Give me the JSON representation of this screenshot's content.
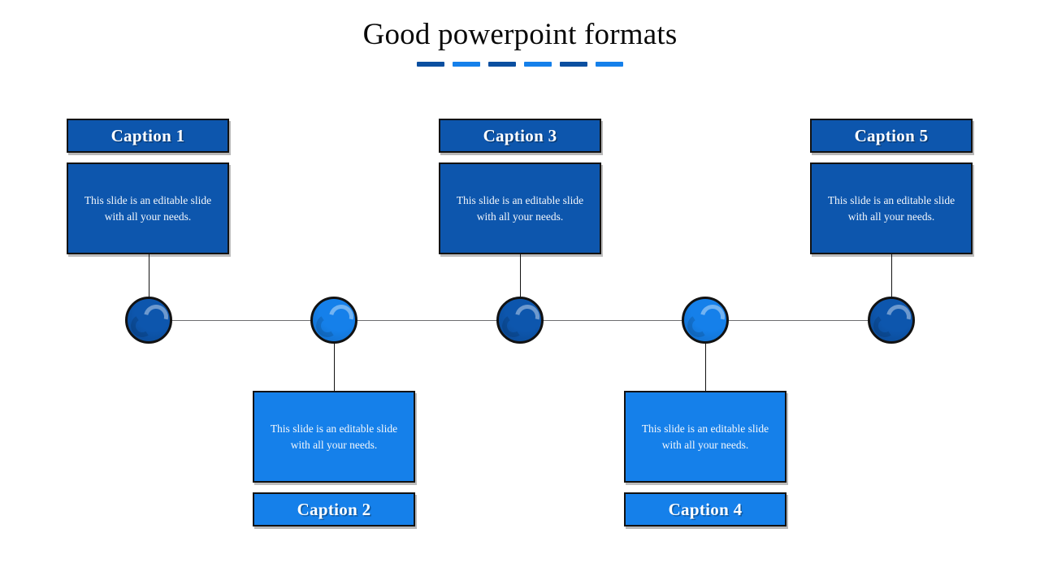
{
  "slide": {
    "title": "Good powerpoint formats",
    "background_color": "#ffffff"
  },
  "theme": {
    "dark_blue": "#0d56ad",
    "bright_blue": "#1580ea",
    "underline_dark": "#0b4fa0",
    "underline_bright": "#1580ea",
    "outline": "#121212",
    "axis_line": "#6e6e70",
    "text_on_fill": "#f2f6fb"
  },
  "title_underline": {
    "dashes": [
      {
        "color": "#0b4fa0"
      },
      {
        "color": "#1580ea"
      },
      {
        "color": "#0b4fa0"
      },
      {
        "color": "#1580ea"
      },
      {
        "color": "#0b4fa0"
      },
      {
        "color": "#1580ea"
      }
    ]
  },
  "timeline": {
    "orientation": "horizontal",
    "node_count": 5,
    "nodes": [
      {
        "index": 1,
        "caption": "Caption 1",
        "body": "This slide is an editable slide with all your needs.",
        "position": "above",
        "color": "#0d56ad",
        "node_color": "#0d56ad"
      },
      {
        "index": 2,
        "caption": "Caption 2",
        "body": "This slide is an editable slide with all your needs.",
        "position": "below",
        "color": "#1580ea",
        "node_color": "#1580ea"
      },
      {
        "index": 3,
        "caption": "Caption 3",
        "body": "This slide is an editable slide with all your needs.",
        "position": "above",
        "color": "#0d56ad",
        "node_color": "#0d56ad"
      },
      {
        "index": 4,
        "caption": "Caption 4",
        "body": "This slide is an editable slide with all your needs.",
        "position": "below",
        "color": "#1580ea",
        "node_color": "#1580ea"
      },
      {
        "index": 5,
        "caption": "Caption 5",
        "body": "This slide is an editable slide with all your needs.",
        "position": "above",
        "color": "#0d56ad",
        "node_color": "#0d56ad"
      }
    ]
  }
}
